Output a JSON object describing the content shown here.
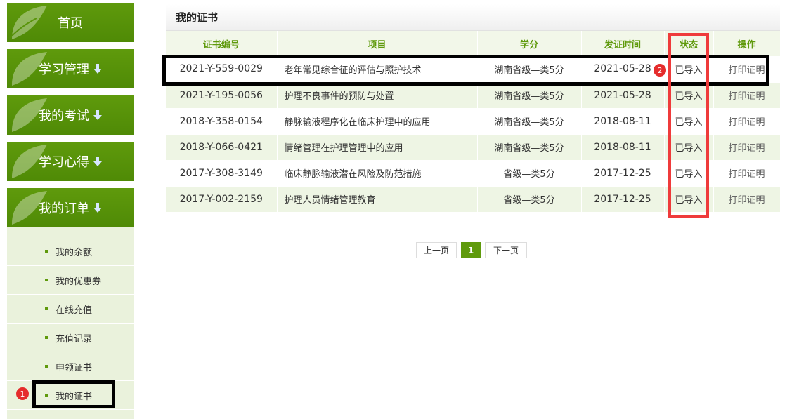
{
  "sidebar": {
    "nav": [
      {
        "label": "首页",
        "arrow": false
      },
      {
        "label": "学习管理",
        "arrow": true
      },
      {
        "label": "我的考试",
        "arrow": true
      },
      {
        "label": "学习心得",
        "arrow": true
      },
      {
        "label": "我的订单",
        "arrow": true
      }
    ],
    "submenu": [
      "我的余额",
      "我的优惠券",
      "在线充值",
      "充值记录",
      "申领证书",
      "我的证书"
    ]
  },
  "annotations": {
    "badge1": "1",
    "badge2": "2"
  },
  "main": {
    "title": "我的证书",
    "headers": [
      "证书编号",
      "项目",
      "学分",
      "发证时间",
      "状态",
      "操作"
    ],
    "rows": [
      {
        "id": "2021-Y-559-0029",
        "project": "老年常见综合征的评估与照护技术",
        "credit": "湖南省级—类5分",
        "date": "2021-05-28",
        "status": "已导入",
        "action": "打印证明"
      },
      {
        "id": "2021-Y-195-0056",
        "project": "护理不良事件的预防与处置",
        "credit": "湖南省级—类5分",
        "date": "2021-05-28",
        "status": "已导入",
        "action": "打印证明"
      },
      {
        "id": "2018-Y-358-0154",
        "project": "静脉输液程序化在临床护理中的应用",
        "credit": "湖南省级—类5分",
        "date": "2018-08-11",
        "status": "已导入",
        "action": "打印证明"
      },
      {
        "id": "2018-Y-066-0421",
        "project": "情绪管理在护理管理中的应用",
        "credit": "湖南省级—类5分",
        "date": "2018-08-11",
        "status": "已导入",
        "action": "打印证明"
      },
      {
        "id": "2017-Y-308-3149",
        "project": "临床静脉输液潜在风险及防范措施",
        "credit": "省级—类5分",
        "date": "2017-12-25",
        "status": "已导入",
        "action": "打印证明"
      },
      {
        "id": "2017-Y-002-2159",
        "project": "护理人员情绪管理教育",
        "credit": "省级—类5分",
        "date": "2017-12-25",
        "status": "已导入",
        "action": "打印证明"
      }
    ],
    "pager": {
      "prev": "上一页",
      "current": "1",
      "next": "下一页"
    }
  },
  "colors": {
    "brand_green": "#5f9a0c",
    "highlight_red": "#ef3b3b",
    "badge_red": "#e52c2c"
  }
}
